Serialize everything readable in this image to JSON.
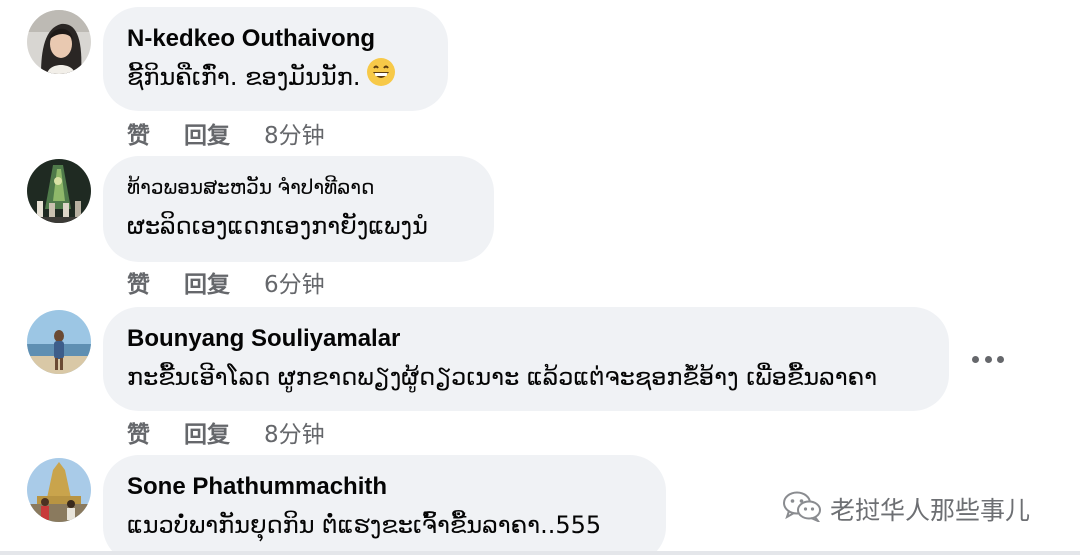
{
  "comments": [
    {
      "author": "N-kedkeo Outhaivong",
      "text": "ຊີ້ກິນຄືເກົ່າ. ຂອງມັນນັກ.",
      "emoji": "grinning-face-icon",
      "like_label": "赞",
      "reply_label": "回复",
      "time": "8分钟"
    },
    {
      "author": "ທ້າວພອນສະຫວັນ ຈຳປາທີລາດ",
      "text": "ຜະລິດເອງແດກເອງກາຍັງແພງນໍ",
      "like_label": "赞",
      "reply_label": "回复",
      "time": "6分钟"
    },
    {
      "author": "Bounyang Souliyamalar",
      "text": "ກະຂື້ນເອີາໂລດ ຜູກຂາດພຽງຜູ້ດຽວເນາະ ແລ້ວແຕ່ຈະຊອກຂໍ້ອ້າງ ເພື່ອຂື້ນລາຄາ",
      "like_label": "赞",
      "reply_label": "回复",
      "time": "8分钟"
    },
    {
      "author": "Sone Phathummachith",
      "text": "ແນວບໍ່ພາກັນຍຸດກິນ ຕໍ່ແຮງຂະເຈົ້າຂື້ນລາຄາ..555"
    }
  ],
  "watermark": {
    "text": "老挝华人那些事儿",
    "icon": "wechat-icon"
  },
  "colors": {
    "bubble": "#f0f2f5",
    "meta": "#65676b",
    "text": "#050505"
  }
}
